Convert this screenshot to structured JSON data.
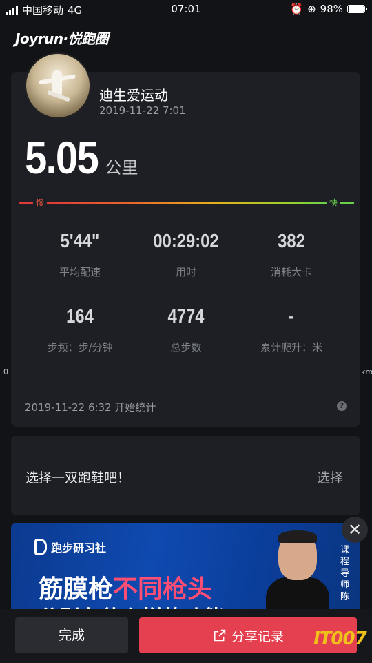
{
  "status_bar": {
    "carrier": "中国移动",
    "network": "4G",
    "time": "07:01",
    "battery": "98%",
    "battery_level": 0.98
  },
  "app": {
    "brand": "Joyrun·悦跑圈"
  },
  "record": {
    "username": "迪生爱运动",
    "datetime": "2019-11-22 7:01",
    "distance": "5.05",
    "distance_unit": "公里",
    "pace_scale": {
      "slow": "慢",
      "fast": "快"
    },
    "stats": [
      {
        "value": "5'44\"",
        "label": "平均配速"
      },
      {
        "value": "00:29:02",
        "label": "用时"
      },
      {
        "value": "382",
        "label": "消耗大卡"
      },
      {
        "value": "164",
        "label": "步频：步/分钟"
      },
      {
        "value": "4774",
        "label": "总步数"
      },
      {
        "value": "-",
        "label": "累计爬升：米"
      }
    ],
    "start_text": "2019-11-22 6:32 开始统计",
    "help_glyph": "?",
    "edge_left": "0",
    "edge_right": "km"
  },
  "shoe": {
    "prompt": "选择一双跑鞋吧！",
    "action": "选择"
  },
  "ad": {
    "brand": "跑步研习社",
    "title_part1": "筋膜枪",
    "title_highlight": "不同枪头",
    "subtitle": "分别有什么样的功能?",
    "tag": "课程导师 陈",
    "close_glyph": "✕"
  },
  "actions": {
    "done": "完成",
    "share": "分享记录"
  },
  "watermark": "IT007",
  "colors": {
    "background": "#121317",
    "card": "#1d1f24",
    "share_button": "#e5404f",
    "pace_slow": "#e23a3a",
    "pace_fast": "#6bd14a",
    "ad_blue": "#0f4ab0",
    "ad_highlight": "#ff4d73"
  }
}
